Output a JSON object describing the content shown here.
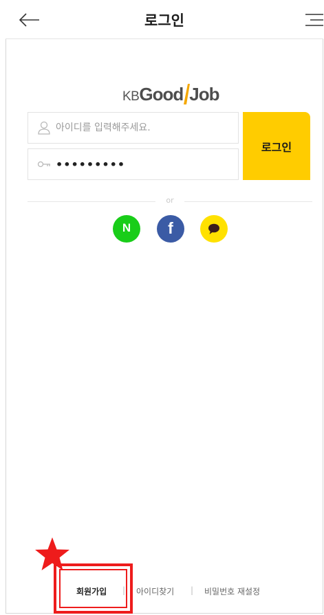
{
  "header": {
    "title": "로그인",
    "back_icon": "arrow-left-icon",
    "menu_icon": "hamburger-menu-icon"
  },
  "logo": {
    "kb": "KB",
    "good": "Good",
    "job": "Job",
    "accent_color": "#f5a800"
  },
  "form": {
    "id_placeholder": "아이디를 입력해주세요.",
    "id_value": "",
    "id_icon": "user-icon",
    "password_value": "•••••••••",
    "password_icon": "key-icon",
    "login_label": "로그인",
    "login_color": "#ffcc00"
  },
  "social": {
    "or_label": "or",
    "buttons": [
      {
        "name": "naver",
        "label": "N",
        "color": "#19cd19"
      },
      {
        "name": "facebook",
        "label": "f",
        "color": "#3b5ba5"
      },
      {
        "name": "kakao",
        "icon": "speech-bubble-icon",
        "color": "#ffe100"
      }
    ]
  },
  "footer": {
    "signup": "회원가입",
    "separator": "|",
    "find_id": "아이디찾기",
    "reset_password": "비밀번호 재설정"
  },
  "annotation": {
    "highlight_color": "#ee1c1c",
    "star_icon": "red-star-icon"
  }
}
